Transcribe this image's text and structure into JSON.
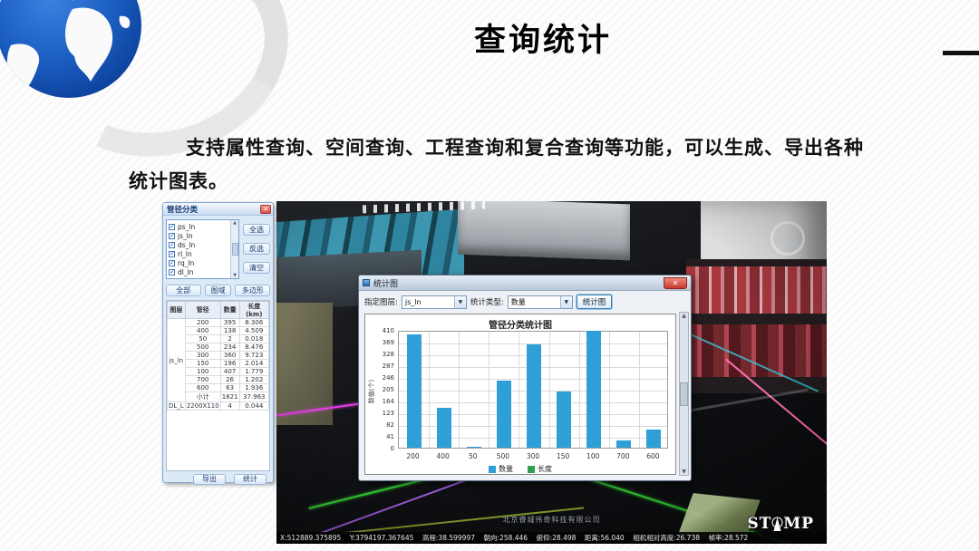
{
  "slide": {
    "title": "查询统计",
    "body_line1": "支持属性查询、空间查询、工程查询和复合查询等功能，可以生成、导出各种",
    "body_line2": "统计图表。"
  },
  "panel": {
    "title": "管径分类",
    "layers": [
      "ps_ln",
      "js_ln",
      "ds_ln",
      "rl_ln",
      "rq_ln",
      "dl_ln"
    ],
    "select_buttons": [
      "全选",
      "反选",
      "清空"
    ],
    "mode_buttons": [
      "全部",
      "图域",
      "多边形"
    ],
    "table": {
      "headers": [
        "图层",
        "管径",
        "数量",
        "长度(km)"
      ],
      "group_layer": "js_ln",
      "group_rows": [
        [
          "200",
          "395",
          "8.306"
        ],
        [
          "400",
          "138",
          "4.509"
        ],
        [
          "50",
          "2",
          "0.018"
        ],
        [
          "500",
          "234",
          "8.476"
        ],
        [
          "300",
          "360",
          "9.723"
        ],
        [
          "150",
          "196",
          "2.014"
        ],
        [
          "100",
          "407",
          "1.779"
        ],
        [
          "700",
          "26",
          "1.202"
        ],
        [
          "600",
          "63",
          "1.936"
        ],
        [
          "小计",
          "1821",
          "37.963"
        ]
      ],
      "extra_row": [
        "DL_L",
        "2200X110",
        "4",
        "0.044"
      ]
    },
    "bottom_buttons": [
      "导出",
      "统计"
    ]
  },
  "stats_window": {
    "title": "统计图",
    "layer_label": "指定图层:",
    "layer_value": "js_ln",
    "type_label": "统计类型:",
    "type_value": "数量",
    "chart_button": "统计图"
  },
  "chart_data": {
    "type": "bar",
    "title": "管径分类统计图",
    "ylabel": "数值(个)",
    "categories": [
      "200",
      "400",
      "50",
      "500",
      "300",
      "150",
      "100",
      "700",
      "600"
    ],
    "series": [
      {
        "name": "数量",
        "color": "#2f9fd8",
        "values": [
          395,
          138,
          2,
          234,
          360,
          196,
          407,
          26,
          63
        ]
      },
      {
        "name": "长度",
        "color": "#2e9e4f",
        "values": []
      }
    ],
    "ylim": [
      0,
      410
    ],
    "yticks": [
      0,
      41,
      82,
      123,
      164,
      205,
      246,
      287,
      328,
      369,
      410
    ],
    "grid": true,
    "legend_position": "bottom"
  },
  "viewport": {
    "company": "北京睿城伟奇科技有限公司",
    "status_segments": [
      "X:512889.375895",
      "Y:3794197.367645",
      "高程:38.599997",
      "朝向:258.446",
      "俯仰:28.498",
      "距离:56.040",
      "相机相对高度:26.738",
      "帧率:28.572"
    ],
    "logo_text": "STAMP"
  },
  "colors": {
    "bar_blue": "#2f9fd8",
    "legend_green": "#2e9e4f",
    "close_red": "#d9534f"
  }
}
